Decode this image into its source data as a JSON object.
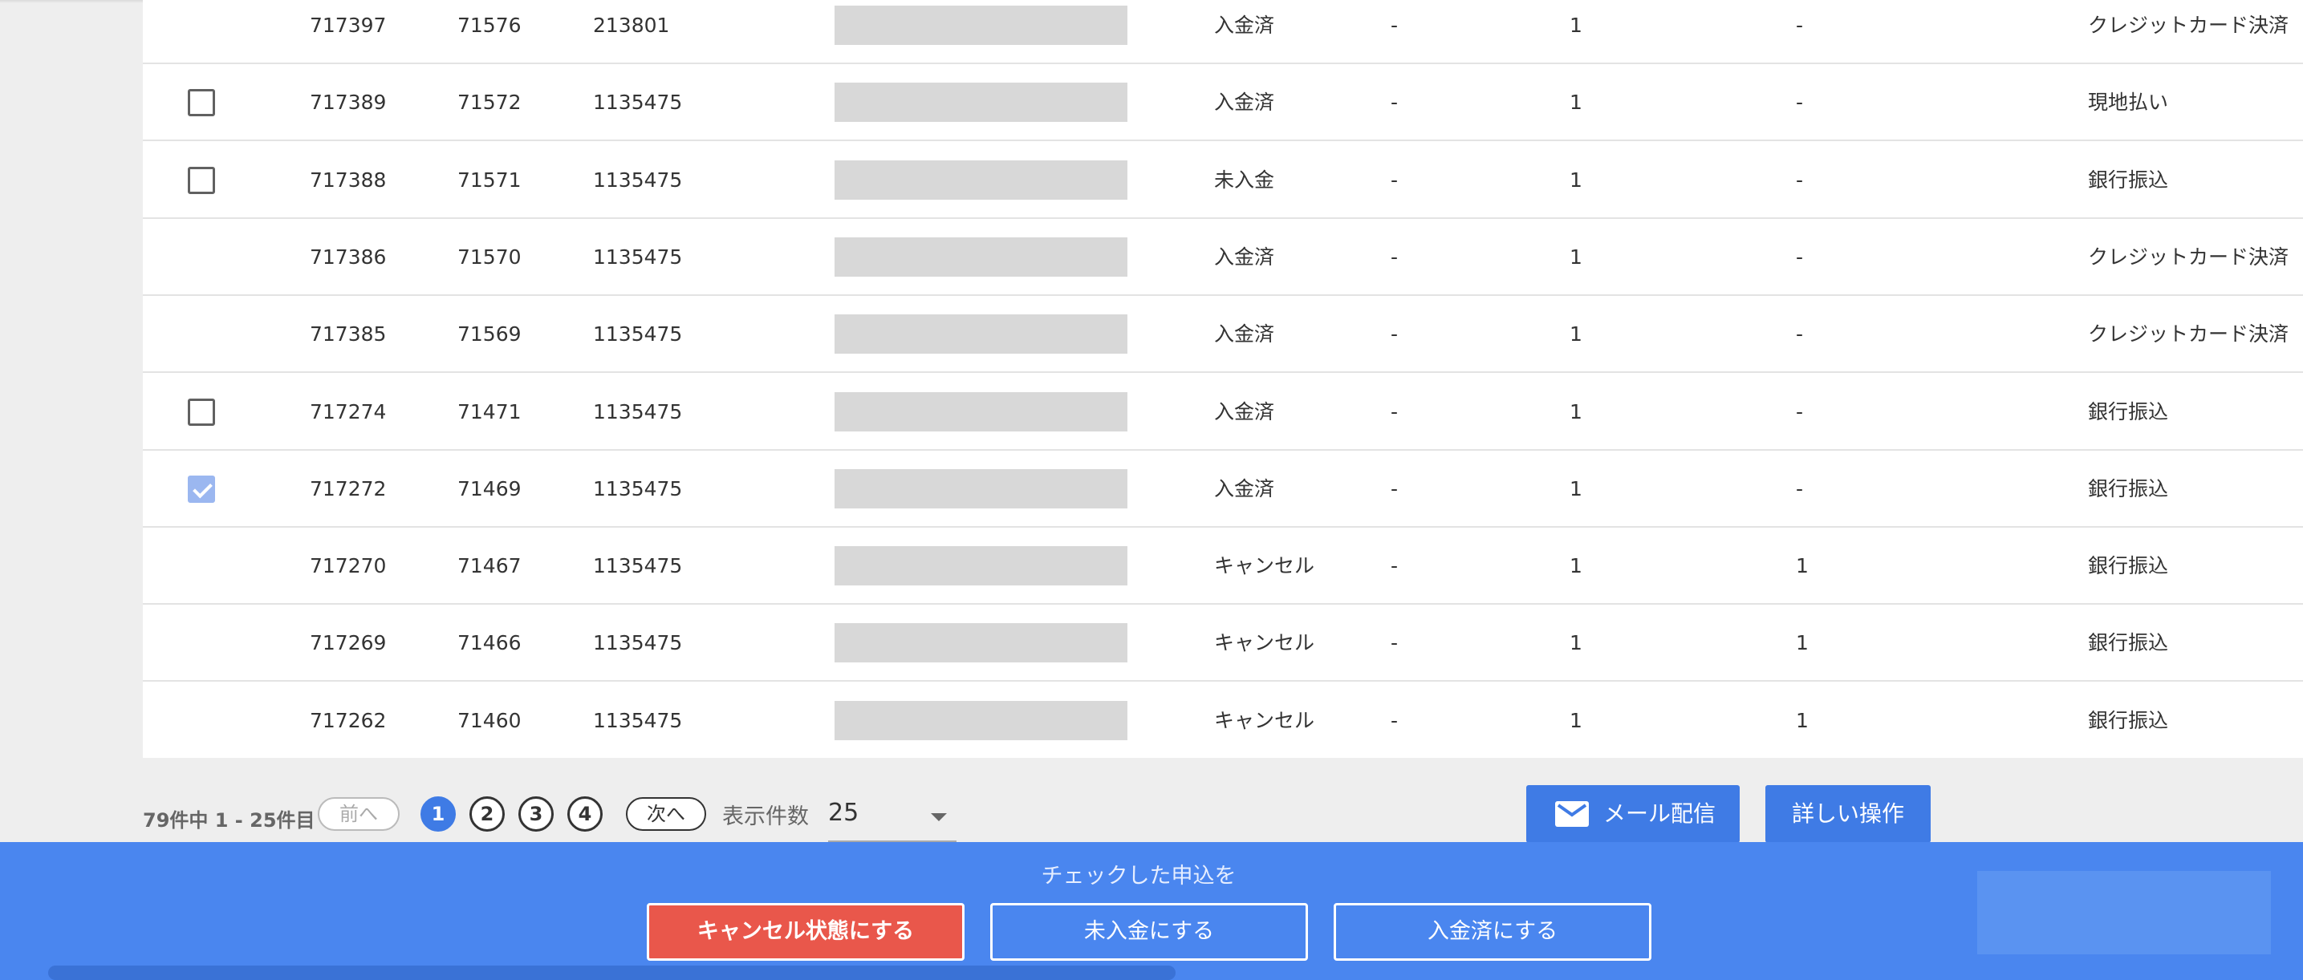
{
  "table": {
    "rows": [
      {
        "checkbox": "none",
        "id": "717397",
        "no": "71576",
        "user": "213801",
        "status": "入金済",
        "dash1": "-",
        "qty": "1",
        "dash2": "-",
        "method": "クレジットカード決済"
      },
      {
        "checkbox": "unchecked",
        "id": "717389",
        "no": "71572",
        "user": "1135475",
        "status": "入金済",
        "dash1": "-",
        "qty": "1",
        "dash2": "-",
        "method": "現地払い"
      },
      {
        "checkbox": "unchecked",
        "id": "717388",
        "no": "71571",
        "user": "1135475",
        "status": "未入金",
        "dash1": "-",
        "qty": "1",
        "dash2": "-",
        "method": "銀行振込"
      },
      {
        "checkbox": "none",
        "id": "717386",
        "no": "71570",
        "user": "1135475",
        "status": "入金済",
        "dash1": "-",
        "qty": "1",
        "dash2": "-",
        "method": "クレジットカード決済"
      },
      {
        "checkbox": "none",
        "id": "717385",
        "no": "71569",
        "user": "1135475",
        "status": "入金済",
        "dash1": "-",
        "qty": "1",
        "dash2": "-",
        "method": "クレジットカード決済"
      },
      {
        "checkbox": "unchecked",
        "id": "717274",
        "no": "71471",
        "user": "1135475",
        "status": "入金済",
        "dash1": "-",
        "qty": "1",
        "dash2": "-",
        "method": "銀行振込"
      },
      {
        "checkbox": "checked",
        "id": "717272",
        "no": "71469",
        "user": "1135475",
        "status": "入金済",
        "dash1": "-",
        "qty": "1",
        "dash2": "-",
        "method": "銀行振込"
      },
      {
        "checkbox": "none",
        "id": "717270",
        "no": "71467",
        "user": "1135475",
        "status": "キャンセル",
        "dash1": "-",
        "qty": "1",
        "dash2": "1",
        "method": "銀行振込"
      },
      {
        "checkbox": "none",
        "id": "717269",
        "no": "71466",
        "user": "1135475",
        "status": "キャンセル",
        "dash1": "-",
        "qty": "1",
        "dash2": "1",
        "method": "銀行振込"
      },
      {
        "checkbox": "none",
        "id": "717262",
        "no": "71460",
        "user": "1135475",
        "status": "キャンセル",
        "dash1": "-",
        "qty": "1",
        "dash2": "1",
        "method": "銀行振込"
      }
    ]
  },
  "pagination": {
    "summary": "79件中 1 - 25件目",
    "prev_label": "前へ",
    "next_label": "次へ",
    "pages": [
      "1",
      "2",
      "3",
      "4"
    ],
    "current_page": "1",
    "per_page_label": "表示件数",
    "per_page_value": "25"
  },
  "actions": {
    "mail_label": "メール配信",
    "mail_icon": "mail-icon",
    "detail_label": "詳しい操作"
  },
  "bulk": {
    "caption": "チェックした申込を",
    "cancel_label": "キャンセル状態にする",
    "unpaid_label": "未入金にする",
    "paid_label": "入金済にする"
  },
  "colors": {
    "accent": "#3f7be5",
    "bar": "#4a86ef",
    "danger": "#e9574b"
  }
}
